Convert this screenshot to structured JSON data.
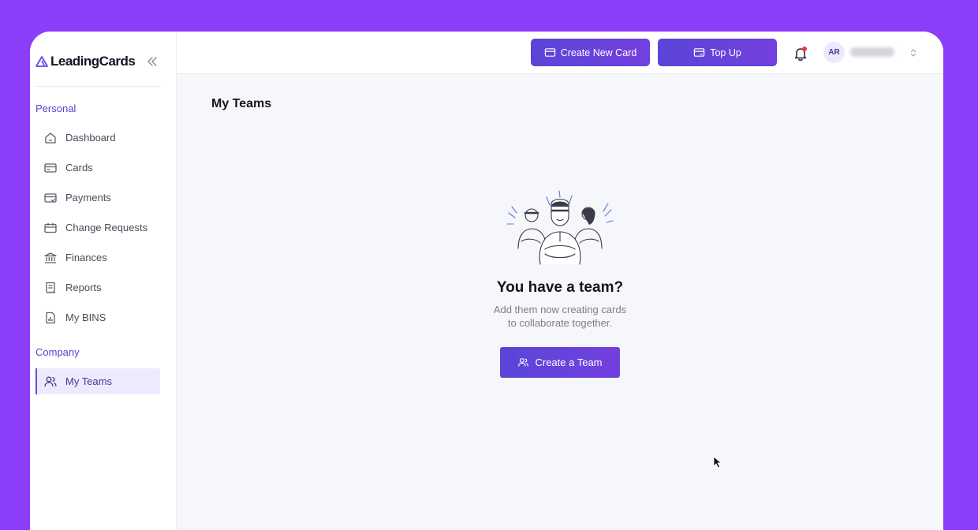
{
  "app": {
    "logo_text": "LeadingCards"
  },
  "sidebar": {
    "sections": [
      {
        "label": "Personal"
      },
      {
        "label": "Company"
      }
    ],
    "items": [
      {
        "label": "Dashboard",
        "icon": "home-icon"
      },
      {
        "label": "Cards",
        "icon": "card-icon"
      },
      {
        "label": "Payments",
        "icon": "payment-card-icon"
      },
      {
        "label": "Change Requests",
        "icon": "calendar-card-icon"
      },
      {
        "label": "Finances",
        "icon": "bank-icon"
      },
      {
        "label": "Reports",
        "icon": "receipt-icon"
      },
      {
        "label": "My BINS",
        "icon": "chart-document-icon"
      },
      {
        "label": "My Teams",
        "icon": "users-icon",
        "active": true
      }
    ]
  },
  "header": {
    "create_card_label": "Create New Card",
    "top_up_label": "Top Up",
    "avatar_initials": "AR",
    "notification_dot_color": "#F03A3A"
  },
  "main": {
    "page_title": "My Teams",
    "empty_state": {
      "title": "You have a team?",
      "subtitle_line1": "Add them now creating cards",
      "subtitle_line2": "to collaborate together.",
      "button_label": "Create a Team"
    }
  },
  "theme": {
    "accent": "#5A45D8",
    "background": "#8B3DF7"
  }
}
